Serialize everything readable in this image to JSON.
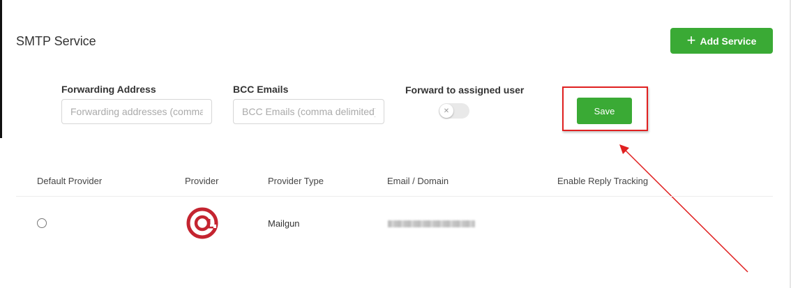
{
  "page": {
    "title": "SMTP Service",
    "add_service_label": "Add Service"
  },
  "form": {
    "forwarding": {
      "label": "Forwarding Address",
      "placeholder": "Forwarding addresses (comma delimited)"
    },
    "bcc": {
      "label": "BCC Emails",
      "placeholder": "BCC Emails (comma delimited)"
    },
    "forward_toggle": {
      "label": "Forward to assigned user",
      "enabled": false
    },
    "save_label": "Save"
  },
  "table": {
    "columns": [
      "Default Provider",
      "Provider",
      "Provider Type",
      "Email / Domain",
      "Enable Reply Tracking"
    ],
    "rows": [
      {
        "default": false,
        "provider_icon": "mailgun-logo",
        "provider_type": "Mailgun",
        "email": "blurred"
      }
    ]
  },
  "colors": {
    "primary_green": "#3aaa35",
    "highlight_red": "#e02020",
    "mailgun_red": "#c42430"
  }
}
